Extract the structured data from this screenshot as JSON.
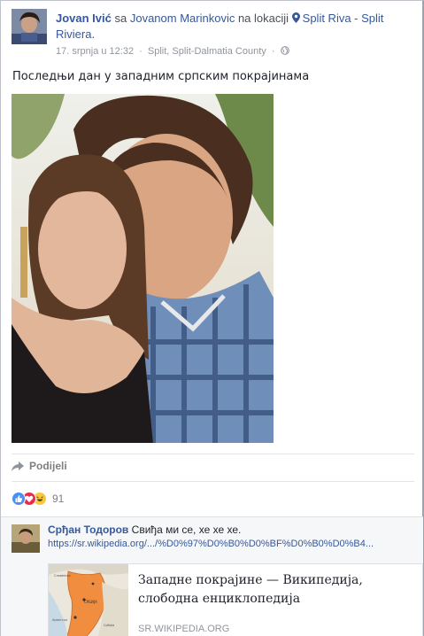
{
  "post": {
    "author": "Jovan Ivić",
    "with_prefix": " sa ",
    "with_name": "Jovanom Marinkovic",
    "at_prefix": " na lokaciji ",
    "location": "Split Riva - Split Riviera",
    "location_end": ".",
    "date": "17. srpnja u 12:32",
    "separator": "·",
    "place": "Split, Split-Dalmatia County",
    "text": "Последњи дан у западним српским покрајинама"
  },
  "actions": {
    "share_label": "Podijeli"
  },
  "reactions": {
    "count": "91",
    "types": [
      "like-icon",
      "love-icon",
      "haha-icon"
    ],
    "colors": {
      "like": "#4a8ff7",
      "love": "#f0284a",
      "haha": "#f7c83e"
    }
  },
  "comment": {
    "author": "Срђан Тодоров",
    "text": "Свиђа ми се, хе хе хе.",
    "url": "https://sr.wikipedia.org/.../%D0%97%D0%B0%D0%BF%D0%B0%D0%B4...",
    "card": {
      "title": "Западне покрајине — Википедија, слободна енциклопедија",
      "domain": "SR.WIKIPEDIA.ORG",
      "map_labels": [
        "Словенија",
        "Хрватска",
        "СРБИЈА",
        "Босна и Херцеговина",
        "Србија"
      ]
    }
  },
  "theme": {
    "link_color": "#365899",
    "muted_color": "#90949c"
  }
}
